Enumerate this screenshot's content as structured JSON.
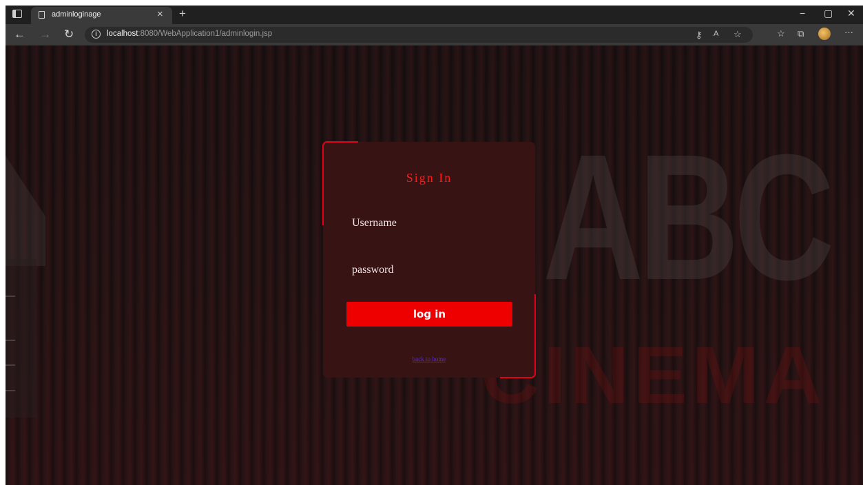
{
  "browser": {
    "tab_title": "adminloginage",
    "new_tab_icon": "+",
    "close_tab_icon": "×",
    "window_controls": [
      "−",
      "▢",
      "✕"
    ],
    "url_host": "localhost",
    "url_rest": ":8080/WebApplication1/adminlogin.jsp",
    "nav_icons": {
      "back": "←",
      "forward": "→",
      "refresh": "↻"
    },
    "toolbar_icons": [
      "key-icon",
      "read-aloud-icon",
      "favorite-add-icon",
      "favorites-icon",
      "collections-icon",
      "profile-icon",
      "more-icon"
    ]
  },
  "background": {
    "brand_large": "ABC",
    "brand_small": "CINEMA"
  },
  "login": {
    "title": "Sign In",
    "username_label": "Username",
    "password_label": "password",
    "submit_label": "log in",
    "back_link": "back to home"
  },
  "colors": {
    "accent": "#ef0000",
    "card_bg": "#381314",
    "title_red": "#ff1a1a",
    "link": "#5a2fb0"
  }
}
